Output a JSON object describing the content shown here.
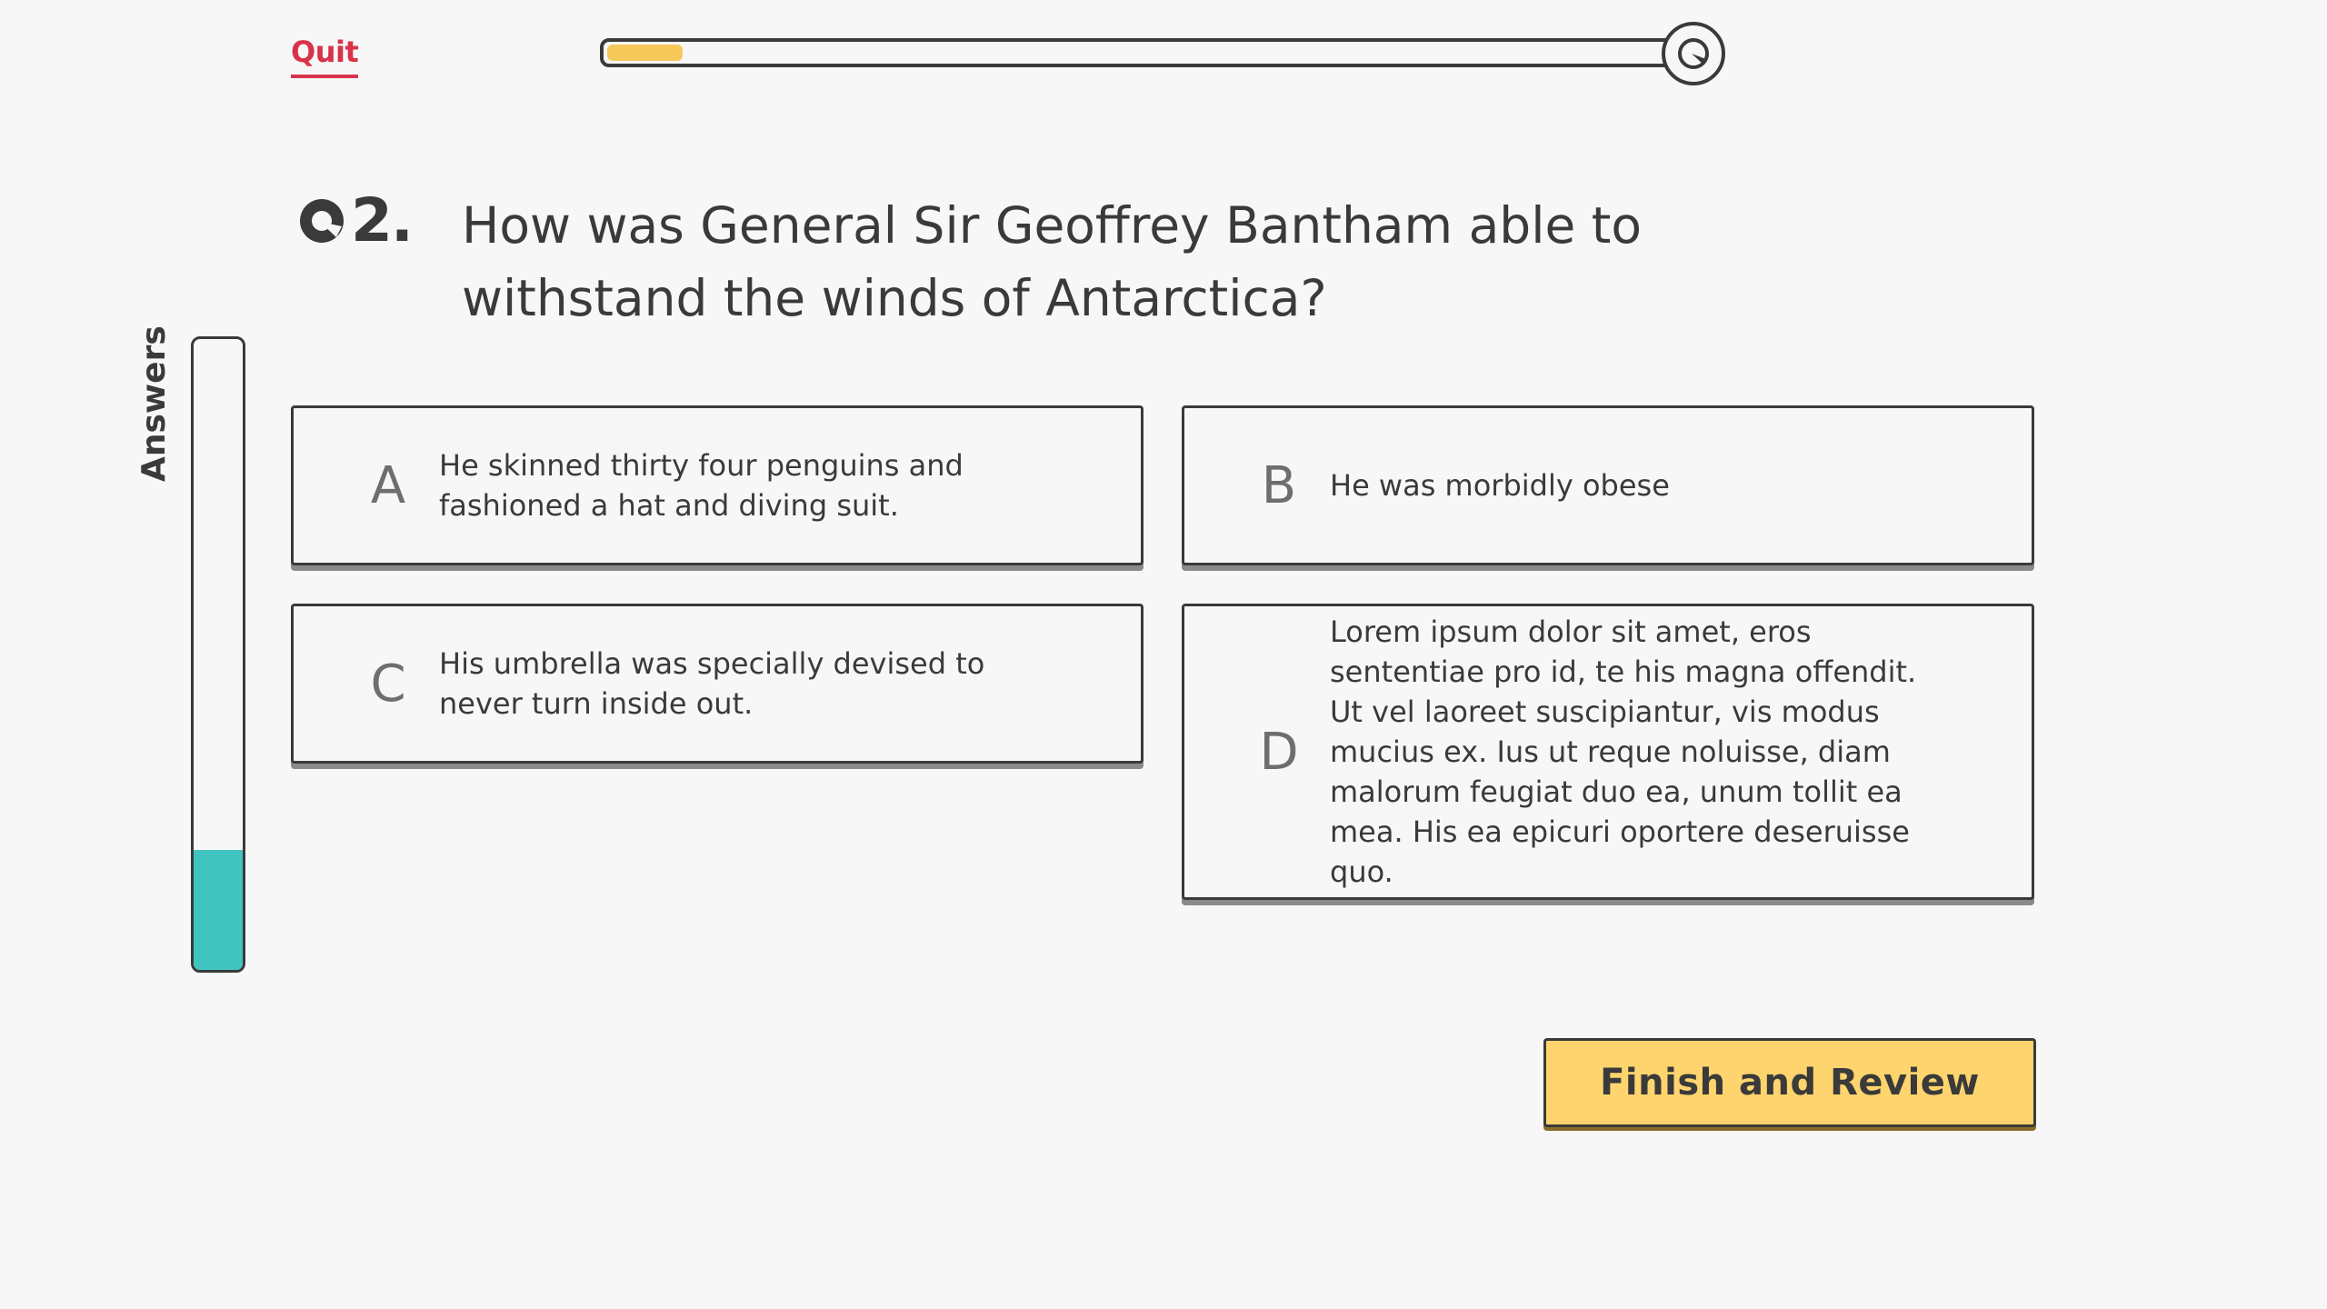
{
  "header": {
    "quit_label": "Quit",
    "progress_fraction": 0.07
  },
  "question": {
    "number": "2.",
    "text": "How was General Sir Geoffrey Bantham able to withstand the winds of Antarctica?"
  },
  "answers_meter": {
    "label": "Answers",
    "fill_fraction": 0.19,
    "fill_color": "#40c4c0"
  },
  "options": [
    {
      "letter": "A",
      "text": "He skinned thirty four penguins and fashioned a hat and diving suit."
    },
    {
      "letter": "B",
      "text": "He was morbidly obese"
    },
    {
      "letter": "C",
      "text": "His umbrella was specially devised to never turn inside out."
    },
    {
      "letter": "D",
      "text": "Lorem ipsum dolor sit amet, eros sententiae pro id, te his magna offendit. Ut vel laoreet suscipiantur, vis modus mucius ex. Ius ut reque noluisse, diam malorum feugiat duo ea, unum tollit ea mea. His ea epicuri oportere deseruisse quo."
    }
  ],
  "footer": {
    "finish_label": "Finish and Review"
  },
  "colors": {
    "accent_red": "#d8334a",
    "progress_yellow": "#f7c85a",
    "button_yellow": "#fed46e",
    "teal": "#40c4c0",
    "text_dark": "#3a3a3a"
  },
  "icons": {
    "progress_end": "quiz-logo-icon",
    "question_prefix": "quiz-logo-icon"
  }
}
